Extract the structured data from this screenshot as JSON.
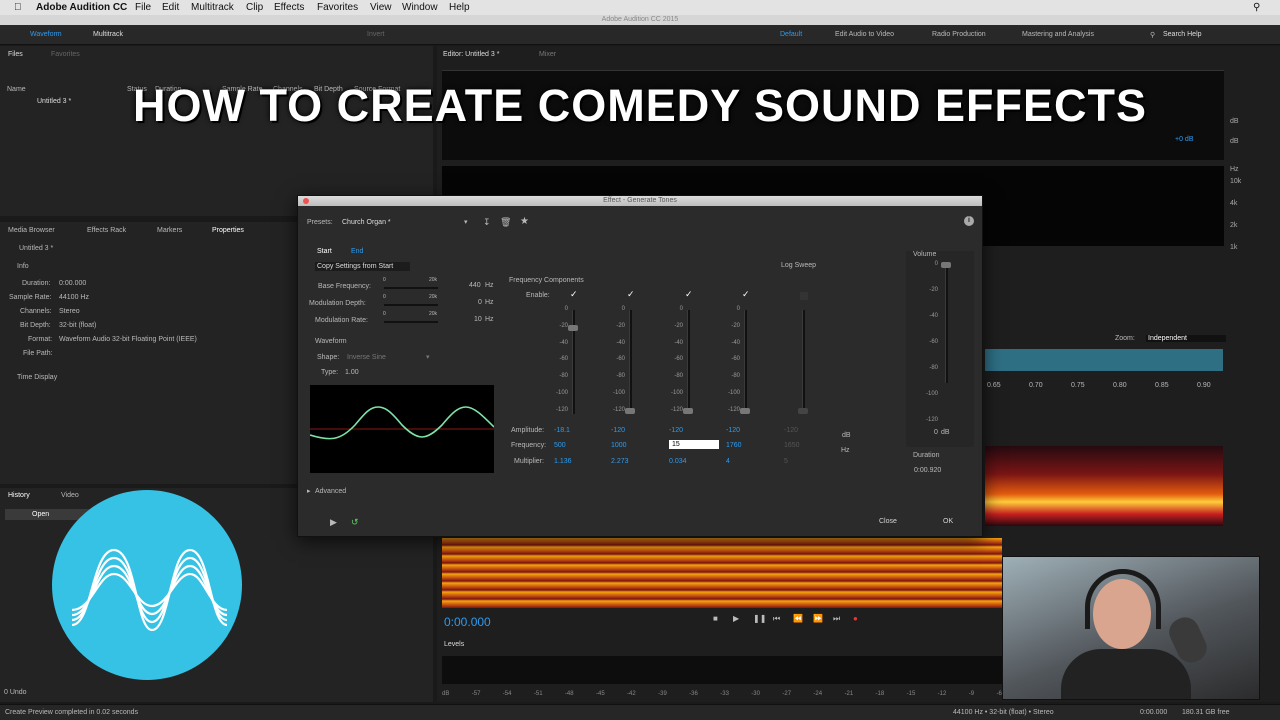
{
  "menubar": {
    "app": "Adobe Audition CC",
    "items": [
      "File",
      "Edit",
      "Multitrack",
      "Clip",
      "Effects",
      "Favorites",
      "View",
      "Window",
      "Help"
    ]
  },
  "window_title": "Adobe Audition CC 2015",
  "toolbar": {
    "waveform": "Waveform",
    "multitrack": "Multitrack",
    "invert": "Invert",
    "workspaces": [
      "Default",
      "Edit Audio to Video",
      "Radio Production",
      "Mastering and Analysis"
    ],
    "search": "Search Help"
  },
  "files_panel": {
    "tab_files": "Files",
    "tab_favorites": "Favorites",
    "col_name": "Name",
    "col_status": "Status",
    "col_duration": "Duration",
    "col_sample_rate": "Sample Rate",
    "col_channels": "Channels",
    "col_bit_depth": "Bit Depth",
    "col_source_format": "Source Format",
    "row_name": "Untitled 3 *"
  },
  "editor": {
    "tab": "Editor: Untitled 3 *",
    "tab_mixer": "Mixer",
    "gain": "+0 dB",
    "zoom_label": "Zoom:",
    "zoom_value": "Independent",
    "ruler": [
      "0.65",
      "0.70",
      "0.75",
      "0.80",
      "0.85",
      "0.90"
    ],
    "hz_labels": [
      "Hz",
      "10k",
      "4k",
      "2k",
      "1k"
    ],
    "db_labels": [
      "dB",
      "dB"
    ],
    "timecode": "0:00.000"
  },
  "props_tabs": {
    "media_browser": "Media Browser",
    "effects_rack": "Effects Rack",
    "markers": "Markers",
    "properties": "Properties"
  },
  "properties": {
    "file": "Untitled 3 *",
    "info_header": "Info",
    "rows": [
      {
        "k": "Duration:",
        "v": "0:00.000"
      },
      {
        "k": "Sample Rate:",
        "v": "44100 Hz"
      },
      {
        "k": "Channels:",
        "v": "Stereo"
      },
      {
        "k": "Bit Depth:",
        "v": "32-bit (float)"
      },
      {
        "k": "Format:",
        "v": "Waveform Audio 32-bit Floating Point (IEEE)"
      },
      {
        "k": "File Path:",
        "v": ""
      }
    ],
    "time_display": "Time Display"
  },
  "history": {
    "tab_history": "History",
    "tab_video": "Video",
    "open": "Open",
    "undo": "0 Undo"
  },
  "overlay_title": "HOW TO CREATE COMEDY SOUND EFFECTS",
  "dialog": {
    "title": "Effect - Generate Tones",
    "presets_label": "Presets:",
    "preset": "Church Organ *",
    "tab_start": "Start",
    "tab_end": "End",
    "copy_settings": "Copy Settings from Start",
    "base_frequency": {
      "label": "Base Frequency:",
      "min": "0",
      "max": "20k",
      "value": "440",
      "unit": "Hz",
      "fraction": 0.022
    },
    "mod_depth": {
      "label": "Modulation Depth:",
      "min": "0",
      "max": "20k",
      "value": "0",
      "unit": "Hz",
      "fraction": 0
    },
    "mod_rate": {
      "label": "Modulation Rate:",
      "min": "0",
      "max": "20k",
      "value": "10",
      "unit": "Hz",
      "fraction": 0
    },
    "waveform_header": "Waveform",
    "shape_label": "Shape:",
    "shape": "Inverse Sine",
    "type_label": "Type:",
    "type_value": "1.00",
    "freq_components": "Frequency Components",
    "log_sweep": "Log Sweep",
    "enable": "Enable:",
    "scale": [
      "0",
      "-20",
      "-40",
      "-60",
      "-80",
      "-100",
      "-120"
    ],
    "amplitude_label": "Amplitude:",
    "frequency_label": "Frequency:",
    "multiplier_label": "Multiplier:",
    "components": [
      {
        "enabled": true,
        "amplitude": "-18.1",
        "frequency": "500",
        "multiplier": "1.136",
        "level": 0.15
      },
      {
        "enabled": true,
        "amplitude": "-120",
        "frequency": "1000",
        "multiplier": "2.273",
        "level": 1
      },
      {
        "enabled": true,
        "amplitude": "-120",
        "frequency": "15",
        "multiplier": "0.034",
        "level": 1
      },
      {
        "enabled": true,
        "amplitude": "-120",
        "frequency": "1760",
        "multiplier": "4",
        "level": 1
      },
      {
        "enabled": false,
        "amplitude": "-120",
        "frequency": "1650",
        "multiplier": "5",
        "level": 1
      }
    ],
    "db_unit": "dB",
    "hz_unit": "Hz",
    "volume_label": "Volume",
    "volume_scale": [
      "0",
      "-20",
      "-40",
      "-60",
      "-80",
      "-100",
      "-120"
    ],
    "volume_value": "0",
    "volume_unit": "dB",
    "duration_label": "Duration",
    "duration_value": "0:00.920",
    "advanced": "Advanced",
    "close": "Close",
    "ok": "OK"
  },
  "levels": {
    "title": "Levels",
    "scale": [
      "dB",
      "-57",
      "-54",
      "-51",
      "-48",
      "-45",
      "-42",
      "-39",
      "-36",
      "-33",
      "-30",
      "-27",
      "-24",
      "-21",
      "-18",
      "-15",
      "-12",
      "-9",
      "-6"
    ]
  },
  "status": {
    "left": "Create Preview completed in 0.02 seconds",
    "format": "44100 Hz • 32-bit (float) • Stereo",
    "time": "0:00.000",
    "free": "180.31 GB free"
  },
  "colors": {
    "accent": "#2d9bf0",
    "wave": "#7de3a8",
    "logo": "#35c2e4"
  }
}
